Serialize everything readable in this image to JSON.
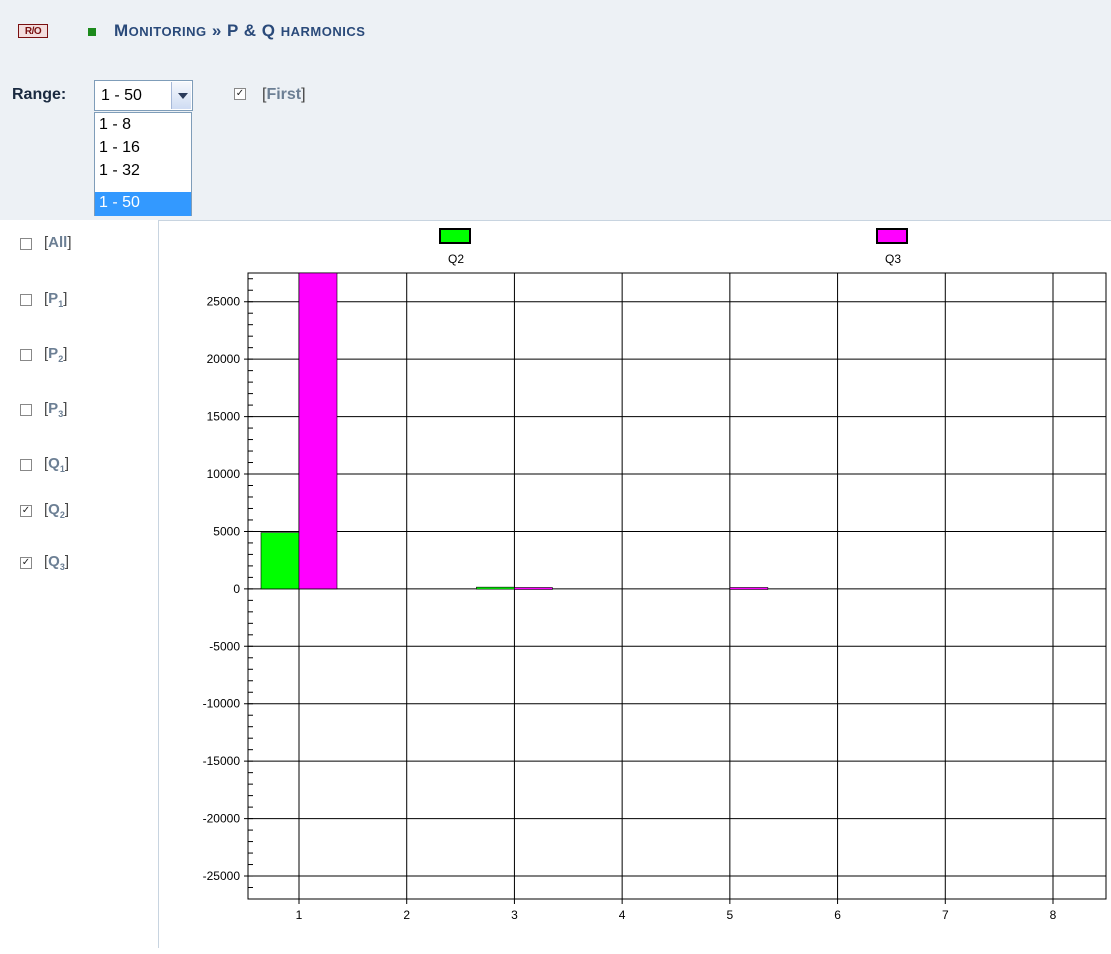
{
  "header": {
    "badge": "R/O",
    "title_parts": [
      "M",
      "ONITORING",
      " » P & Q ",
      "HARMONICS"
    ]
  },
  "range": {
    "label": "Range:",
    "selected": "1 - 50",
    "options": [
      "1 - 8",
      "1 - 16",
      "1 - 32",
      "1 - 50"
    ]
  },
  "first_toggle": {
    "label": "First",
    "checked": true
  },
  "series_toggles": [
    {
      "label": "All",
      "checked": false
    },
    {
      "label": "P",
      "sub": "1",
      "checked": false
    },
    {
      "label": "P",
      "sub": "2",
      "checked": false
    },
    {
      "label": "P",
      "sub": "3",
      "checked": false
    },
    {
      "label": "Q",
      "sub": "1",
      "checked": false
    },
    {
      "label": "Q",
      "sub": "2",
      "checked": true
    },
    {
      "label": "Q",
      "sub": "3",
      "checked": true
    }
  ],
  "chart_data": {
    "type": "bar",
    "categories": [
      "1",
      "2",
      "3",
      "4",
      "5",
      "6",
      "7",
      "8"
    ],
    "series": [
      {
        "name": "Q2",
        "color": "#00ff00",
        "values": [
          4900,
          0,
          150,
          0,
          0,
          0,
          0,
          0
        ]
      },
      {
        "name": "Q3",
        "color": "#ff00ff",
        "values": [
          27500,
          0,
          120,
          0,
          120,
          0,
          0,
          0
        ]
      }
    ],
    "ylim": [
      -27000,
      27500
    ],
    "yticks": [
      -25000,
      -20000,
      -15000,
      -10000,
      -5000,
      0,
      5000,
      10000,
      15000,
      20000,
      25000
    ],
    "grid": true,
    "legend": "top"
  }
}
